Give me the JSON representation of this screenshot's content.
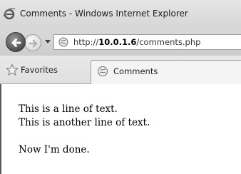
{
  "window": {
    "title": "Comments - Windows Internet Explorer"
  },
  "navigation": {
    "address_prefix": "http://",
    "address_host": "10.0.1.6",
    "address_path": "/comments.php"
  },
  "favorites_bar": {
    "favorites_label": "Favorites",
    "tab_label": "Comments"
  },
  "page": {
    "lines": [
      "This is a line of text.",
      "This is another line of text.",
      "Now I'm done."
    ]
  },
  "icons": {
    "app": "internet-explorer-icon",
    "back": "back-arrow-icon",
    "forward": "forward-arrow-icon",
    "dropdown": "chevron-down-icon",
    "site": "site-favicon-icon",
    "favorites": "star-icon",
    "tab": "page-favicon-icon"
  }
}
